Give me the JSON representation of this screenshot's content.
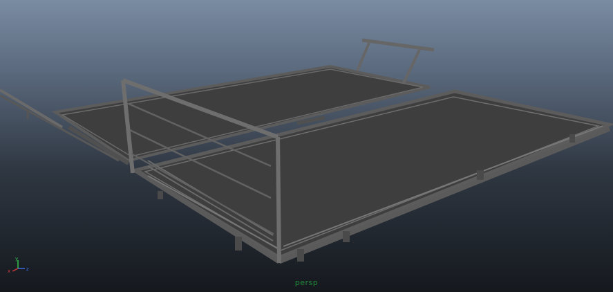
{
  "viewport": {
    "camera_label": "persp"
  },
  "axis_gizmo": {
    "x_label": "x",
    "y_label": "y",
    "z_label": "z",
    "x_color": "#d23a3a",
    "y_color": "#35c24a",
    "z_color": "#3a6de0"
  },
  "colors": {
    "deck_fill": "#3e3e3f",
    "frame_stroke": "#5c5c5c",
    "frame_edge": "#7a7a7a",
    "rail": "#707070"
  },
  "icons": [
    "axis-gizmo-icon"
  ]
}
